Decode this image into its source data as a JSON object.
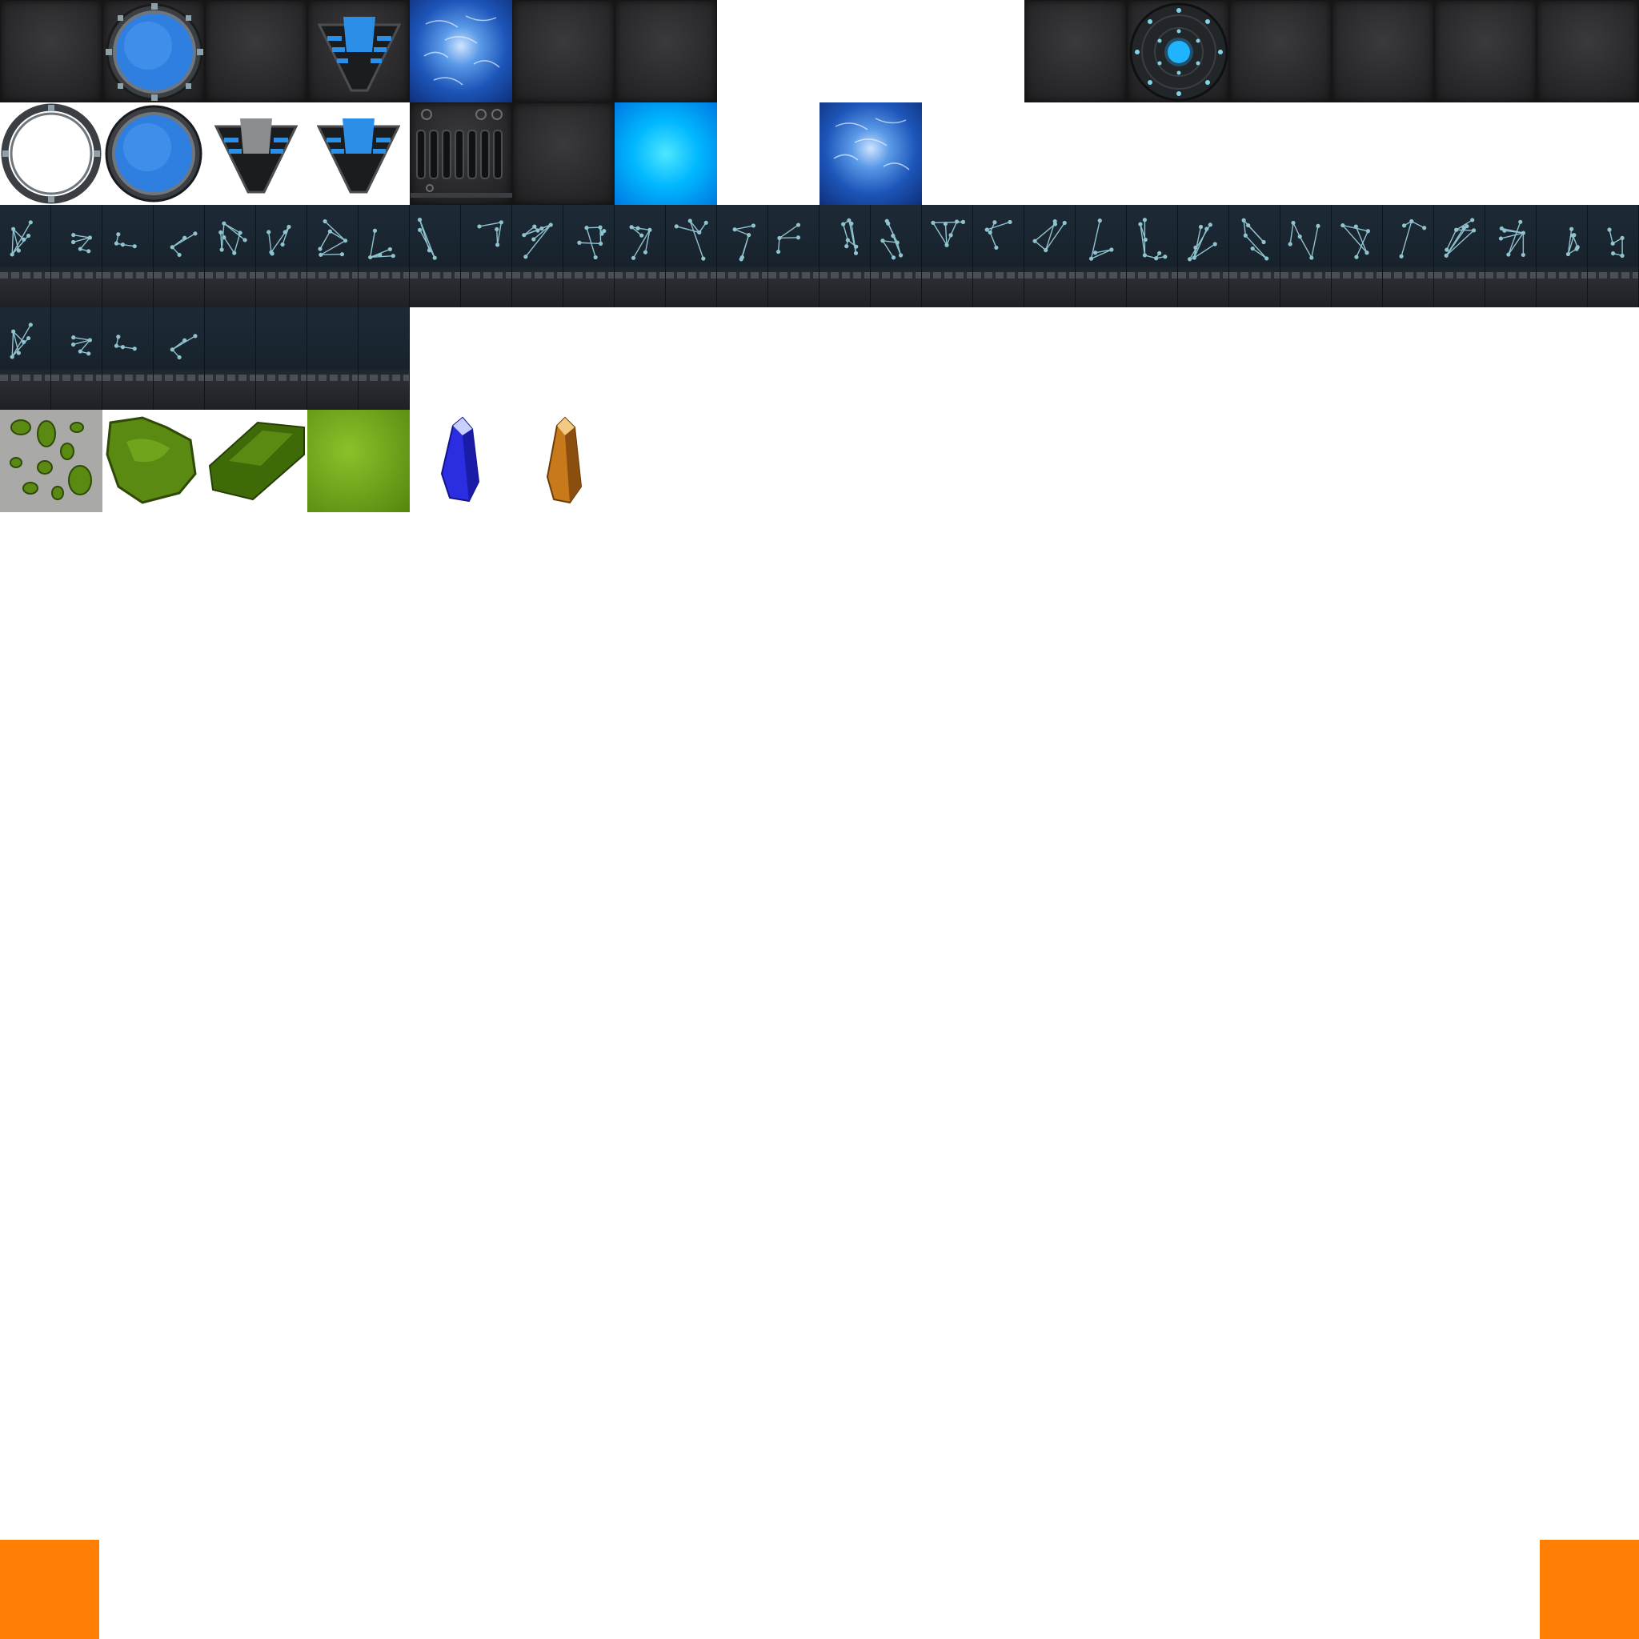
{
  "atlas": {
    "row1": [
      {
        "icon": "metal-panel-icon"
      },
      {
        "icon": "stargate-active-icon"
      },
      {
        "icon": "metal-panel-icon"
      },
      {
        "icon": "chevron-lit-icon"
      },
      {
        "icon": "event-horizon-icon"
      },
      {
        "icon": "metal-panel-icon"
      },
      {
        "icon": "metal-panel-icon"
      },
      {
        "icon": "metal-panel-icon"
      },
      {
        "icon": "dhd-dial-icon"
      },
      {
        "icon": "metal-panel-icon"
      },
      {
        "icon": "metal-panel-icon"
      },
      {
        "icon": "metal-panel-icon"
      },
      {
        "icon": "metal-panel-icon"
      }
    ],
    "row2": [
      {
        "icon": "stargate-inactive-icon"
      },
      {
        "icon": "stargate-active-icon"
      },
      {
        "icon": "chevron-unlit-icon"
      },
      {
        "icon": "chevron-lit-icon"
      },
      {
        "icon": "grille-panel-icon"
      },
      {
        "icon": "metal-panel-icon"
      },
      {
        "icon": "blue-glow-icon"
      },
      {
        "icon": "event-horizon-icon"
      }
    ],
    "glyph_row_1_count": 32,
    "glyph_row_2_count": 8,
    "glyph_row_2_marked": 4,
    "materials": [
      {
        "icon": "naquadah-ore-spots-icon"
      },
      {
        "icon": "naquadah-chunk-icon"
      },
      {
        "icon": "naquadah-ingot-icon"
      },
      {
        "icon": "naquadah-block-icon"
      },
      {
        "icon": "blue-crystal-icon"
      },
      {
        "icon": "orange-crystal-icon"
      }
    ],
    "colors": {
      "metal": "#2b2b2d",
      "event_horizon": "#2f7fe0",
      "glow": "#00b8ff",
      "glyph_bg": "#1d2a36",
      "glyph_stroke": "#8fc3cf",
      "naquadah": "#5a8a12",
      "crystal_blue": "#2a2ee0",
      "crystal_orange": "#c87a1a",
      "marker": "#ff7f06"
    }
  }
}
